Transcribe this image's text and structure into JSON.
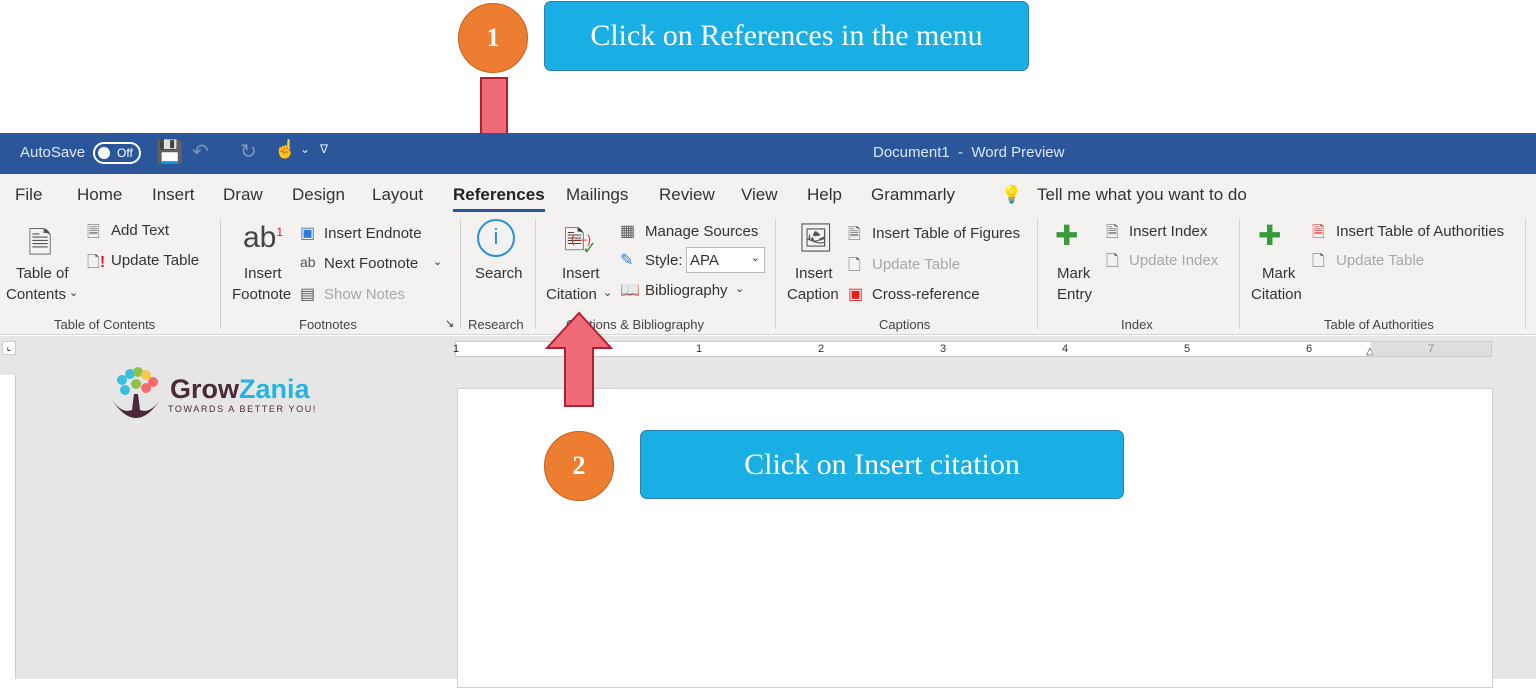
{
  "annotations": {
    "step1_number": "1",
    "step1_text": "Click on References in the menu",
    "step2_number": "2",
    "step2_text": "Click on Insert citation"
  },
  "titlebar": {
    "autosave": "AutoSave",
    "toggle": "Off",
    "title": "Document1  -  Word Preview"
  },
  "tabs": [
    "File",
    "Home",
    "Insert",
    "Draw",
    "Design",
    "Layout",
    "References",
    "Mailings",
    "Review",
    "View",
    "Help",
    "Grammarly"
  ],
  "tell_me": "Tell me what you want to do",
  "ribbon": {
    "toc": {
      "big_line1": "Table of",
      "big_line2": "Contents",
      "add_text": "Add Text",
      "update_table": "Update Table",
      "group": "Table of Contents"
    },
    "footnotes": {
      "big_line1": "Insert",
      "big_line2": "Footnote",
      "insert_endnote": "Insert Endnote",
      "next_footnote": "Next Footnote",
      "show_notes": "Show Notes",
      "group": "Footnotes"
    },
    "research": {
      "search": "Search",
      "group": "Research"
    },
    "citations": {
      "big_line1": "Insert",
      "big_line2": "Citation",
      "manage_sources": "Manage Sources",
      "style_label": "Style:",
      "style_value": "APA",
      "bibliography": "Bibliography",
      "group": "Citations & Bibliography"
    },
    "captions": {
      "big_line1": "Insert",
      "big_line2": "Caption",
      "insert_tof": "Insert Table of Figures",
      "update_table": "Update Table",
      "cross_reference": "Cross-reference",
      "group": "Captions"
    },
    "index": {
      "big_line1": "Mark",
      "big_line2": "Entry",
      "insert_index": "Insert Index",
      "update_index": "Update Index",
      "group": "Index"
    },
    "toa": {
      "big_line1": "Mark",
      "big_line2": "Citation",
      "insert_toa": "Insert Table of Authorities",
      "update_table": "Update Table",
      "group": "Table of Authorities"
    }
  },
  "ruler": [
    "1",
    "1",
    "2",
    "3",
    "4",
    "5",
    "6",
    "7"
  ],
  "logo": {
    "name_part1": "Grow",
    "name_part2": "Zania",
    "tagline": "TOWARDS A BETTER YOU!"
  },
  "colors": {
    "titlebar": "#2b579a",
    "callout": "#19afe5",
    "step_circle": "#ed7d31",
    "arrow": "#f06a78"
  }
}
